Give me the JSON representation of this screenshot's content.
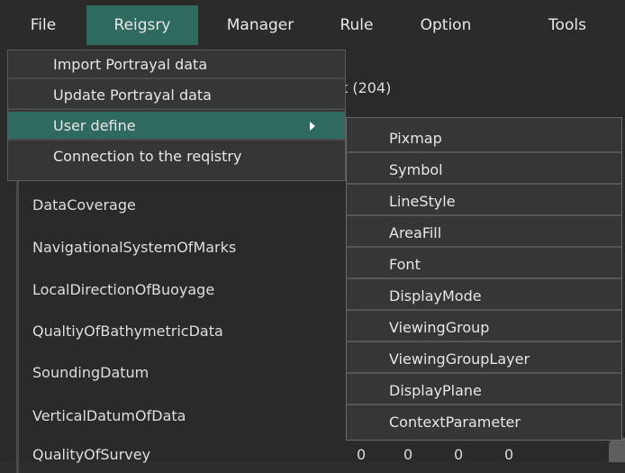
{
  "menubar": {
    "items": [
      "File",
      "Reigsry",
      "Manager",
      "Rule",
      "Option",
      "Tools"
    ],
    "active_index": 1
  },
  "background_list": {
    "partial_header": "t (204)",
    "rows": [
      "DataCoverage",
      "NavigationalSystemOfMarks",
      "LocalDirectionOfBuoyage",
      "QualtiyOfBathymetricData",
      "SoundingDatum",
      "VerticalDatumOfData",
      "QualityOfSurvey"
    ],
    "last_row_values": [
      "0",
      "0",
      "0",
      "0"
    ]
  },
  "dropdown": {
    "items": [
      "Import Portrayal data",
      "Update Portrayal data",
      "User define",
      "Connection to the reqistry"
    ],
    "highlighted_index": 2
  },
  "submenu": {
    "items": [
      "Pixmap",
      "Symbol",
      "LineStyle",
      "AreaFill",
      "Font",
      "DisplayMode",
      "ViewingGroup",
      "ViewingGroupLayer",
      "DisplayPlane",
      "ContextParameter"
    ]
  },
  "colors": {
    "accent": "#2f6a5e",
    "background": "#2d2d2d",
    "menu_bg": "#363636"
  }
}
